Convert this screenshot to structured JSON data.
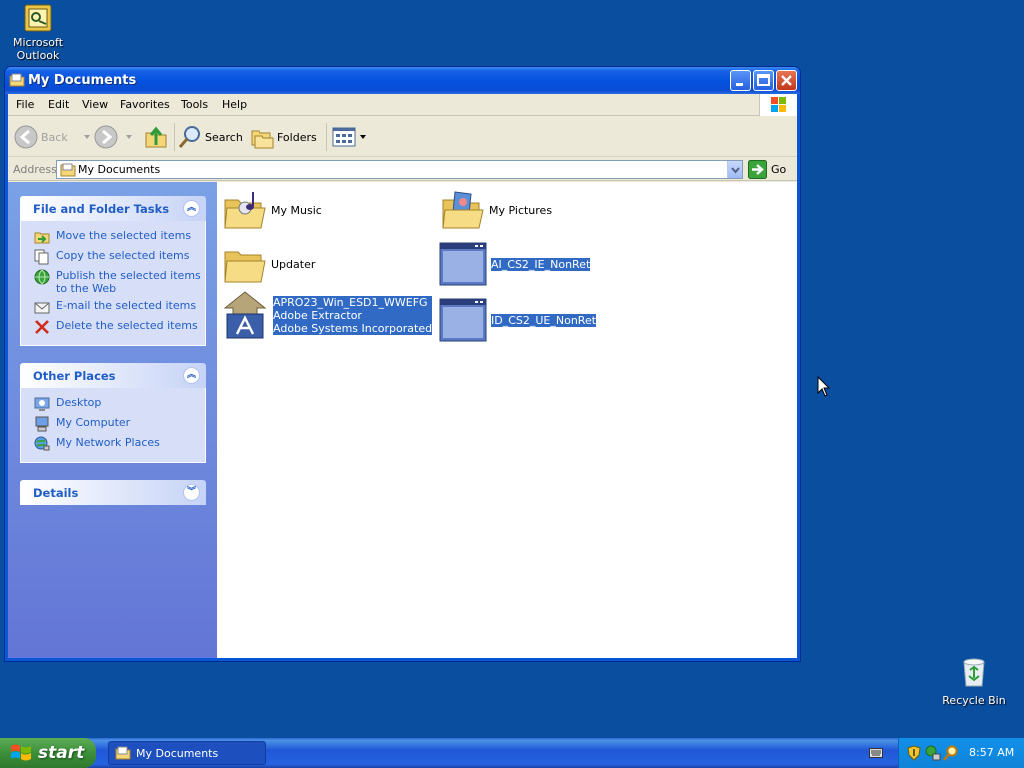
{
  "desktop": {
    "outlook_label": "Microsoft Outlook",
    "recycle_label": "Recycle Bin"
  },
  "window": {
    "title": "My Documents",
    "menu": [
      "File",
      "Edit",
      "View",
      "Favorites",
      "Tools",
      "Help"
    ],
    "toolbar": {
      "back": "Back",
      "search": "Search",
      "folders": "Folders"
    },
    "address": {
      "label": "Address",
      "value": "My Documents",
      "go": "Go"
    }
  },
  "tasks_panel": {
    "title": "File and Folder Tasks",
    "items": [
      "Move the selected items",
      "Copy the selected items",
      "Publish the selected items to the Web",
      "E-mail the selected items",
      "Delete the selected items"
    ]
  },
  "places_panel": {
    "title": "Other Places",
    "items": [
      "Desktop",
      "My Computer",
      "My Network Places"
    ]
  },
  "details_panel": {
    "title": "Details"
  },
  "files": {
    "my_music": "My Music",
    "my_pictures": "My Pictures",
    "updater": "Updater",
    "ai_cs2": "AI_CS2_IE_NonRet",
    "apro_line1": "APRO23_Win_ESD1_WWEFG",
    "apro_line2": "Adobe Extractor",
    "apro_line3": "Adobe Systems Incorporated",
    "id_cs2": "ID_CS2_UE_NonRet"
  },
  "taskbar": {
    "start": "start",
    "task": "My Documents",
    "clock": "8:57 AM"
  }
}
